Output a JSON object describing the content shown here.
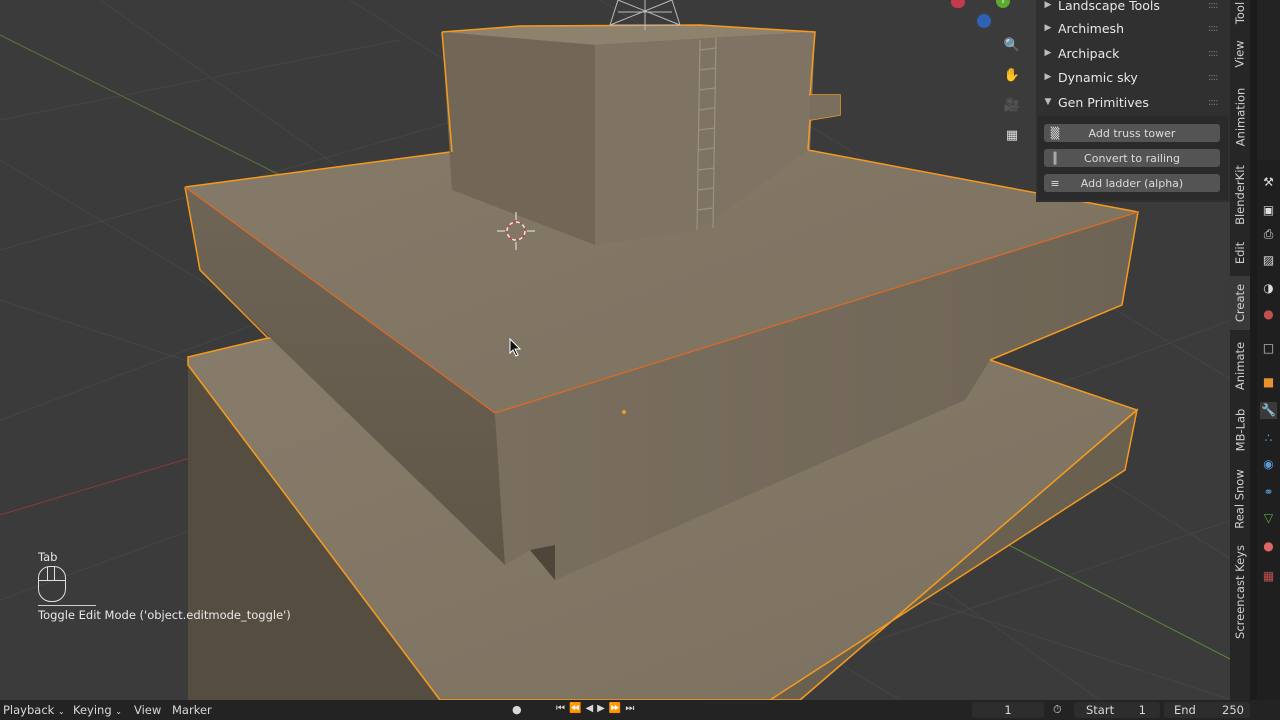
{
  "npanel": {
    "sections": [
      {
        "label": "Landscape Tools",
        "expanded": false
      },
      {
        "label": "Archimesh",
        "expanded": false
      },
      {
        "label": "Archipack",
        "expanded": false
      },
      {
        "label": "Dynamic sky",
        "expanded": false
      },
      {
        "label": "Gen Primitives",
        "expanded": true
      }
    ],
    "buttons": [
      {
        "label": "Add truss tower",
        "icon": "tower-icon"
      },
      {
        "label": "Convert to railing",
        "icon": "railing-icon"
      },
      {
        "label": "Add ladder (alpha)",
        "icon": "ladder-icon"
      }
    ]
  },
  "vtabs": [
    "Tool",
    "View",
    "Animation",
    "BlenderKit",
    "Edit",
    "Create",
    "Animate",
    "MB-Lab",
    "Real Snow",
    "Screencast Keys"
  ],
  "active_tab": "Create",
  "screencast": {
    "key": "Tab",
    "operator": "Toggle Edit Mode ('object.editmode_toggle')"
  },
  "timeline": {
    "playback": "Playback",
    "keying": "Keying",
    "view": "View",
    "marker": "Marker",
    "current_frame": "1",
    "start_label": "Start",
    "start_value": "1",
    "end_label": "End",
    "end_value": "250"
  },
  "colors": {
    "selection_outline": "#f59a1e",
    "mesh_face": "#8a7e6c",
    "viewport_bg": "#3b3b3b"
  }
}
